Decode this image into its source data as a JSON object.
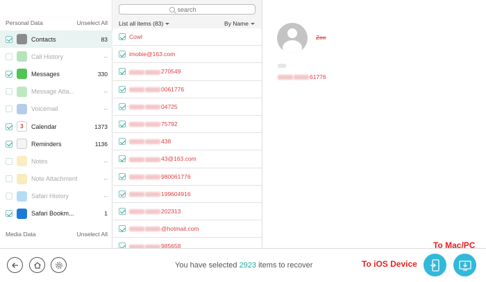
{
  "sidebar": {
    "personal_header": "Personal Data",
    "personal_action": "Unselect All",
    "media_header": "Media Data",
    "media_action": "Unselect All",
    "categories": [
      {
        "label": "Contacts",
        "count": "83",
        "checked": true,
        "enabled": true,
        "selected": true,
        "icon": "contacts-icon"
      },
      {
        "label": "Call History",
        "count": "--",
        "checked": false,
        "enabled": false,
        "icon": "phone-icon"
      },
      {
        "label": "Messages",
        "count": "330",
        "checked": true,
        "enabled": true,
        "icon": "messages-icon"
      },
      {
        "label": "Message Atta...",
        "count": "--",
        "checked": false,
        "enabled": false,
        "icon": "message-attachment-icon"
      },
      {
        "label": "Voicemail",
        "count": "--",
        "checked": false,
        "enabled": false,
        "icon": "voicemail-icon"
      },
      {
        "label": "Calendar",
        "count": "1373",
        "checked": true,
        "enabled": true,
        "icon": "calendar-icon",
        "icon_text": "3"
      },
      {
        "label": "Reminders",
        "count": "1136",
        "checked": true,
        "enabled": true,
        "icon": "reminders-icon"
      },
      {
        "label": "Notes",
        "count": "--",
        "checked": false,
        "enabled": false,
        "icon": "notes-icon"
      },
      {
        "label": "Note Attachment",
        "count": "--",
        "checked": false,
        "enabled": false,
        "icon": "note-attachment-icon"
      },
      {
        "label": "Safari History",
        "count": "--",
        "checked": false,
        "enabled": false,
        "icon": "safari-icon"
      },
      {
        "label": "Safari Bookm...",
        "count": "1",
        "checked": true,
        "enabled": true,
        "icon": "safari-bookmark-icon"
      }
    ]
  },
  "search": {
    "placeholder": "search"
  },
  "list": {
    "header_left": "List all items (83)",
    "sort_label": "By Name",
    "items": [
      {
        "name": "Cowl",
        "blurred": false
      },
      {
        "name": "imobie@163.com",
        "blurred": false
      },
      {
        "name": "270549",
        "blurred": true
      },
      {
        "name": "0061776",
        "blurred": true
      },
      {
        "name": "04725",
        "blurred": true
      },
      {
        "name": "75792",
        "blurred": true
      },
      {
        "name": "438",
        "blurred": true
      },
      {
        "name": "43@163.com",
        "blurred": true
      },
      {
        "name": "980061776",
        "blurred": true
      },
      {
        "name": "199604916",
        "blurred": true
      },
      {
        "name": "202313",
        "blurred": true
      },
      {
        "name": "@hotmail.com",
        "blurred": true
      },
      {
        "name": "985658",
        "blurred": true
      }
    ]
  },
  "detail": {
    "name": "Zee",
    "phone": "61776"
  },
  "bottom": {
    "status_prefix": "You have selected",
    "status_count": "2923",
    "status_suffix": "items to recover"
  },
  "annotations": {
    "to_ios": "To iOS Device",
    "to_mac": "To Mac/PC"
  },
  "colors": {
    "accent": "#24a89c",
    "action_button": "#32b9d9",
    "annotation_red": "#e62020"
  }
}
